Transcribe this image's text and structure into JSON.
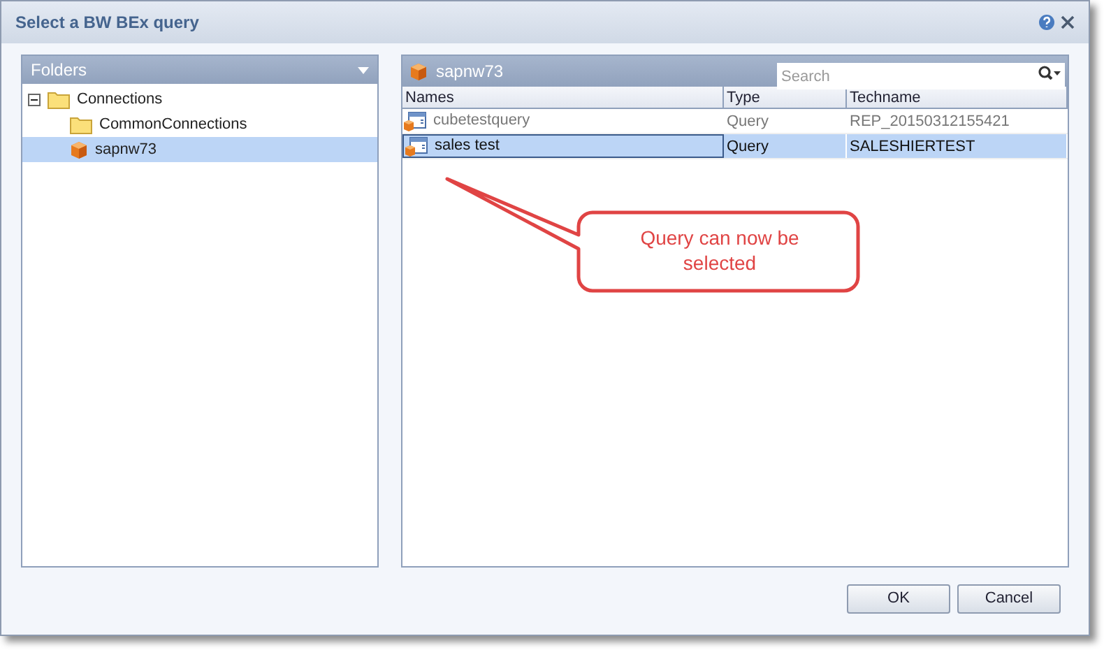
{
  "window": {
    "title": "Select a BW BEx query"
  },
  "folders": {
    "title": "Folders",
    "tree": [
      {
        "label": "Connections",
        "kind": "folder",
        "expanded": true,
        "selected": false,
        "children": [
          {
            "label": "CommonConnections",
            "kind": "folder",
            "selected": false
          },
          {
            "label": "sapnw73",
            "kind": "cube",
            "selected": true
          }
        ]
      }
    ]
  },
  "content": {
    "title": "sapnw73",
    "search": {
      "placeholder": "Search"
    },
    "table": {
      "columns": [
        "Names",
        "Type",
        "Techname"
      ],
      "rows": [
        {
          "name": "cubetestquery",
          "type": "Query",
          "techname": "REP_20150312155421",
          "selected": false
        },
        {
          "name": "sales test",
          "type": "Query",
          "techname": "SALESHIERTEST",
          "selected": true
        }
      ]
    }
  },
  "callout": {
    "text": "Query can now be selected"
  },
  "buttons": [
    "OK",
    "Cancel"
  ]
}
